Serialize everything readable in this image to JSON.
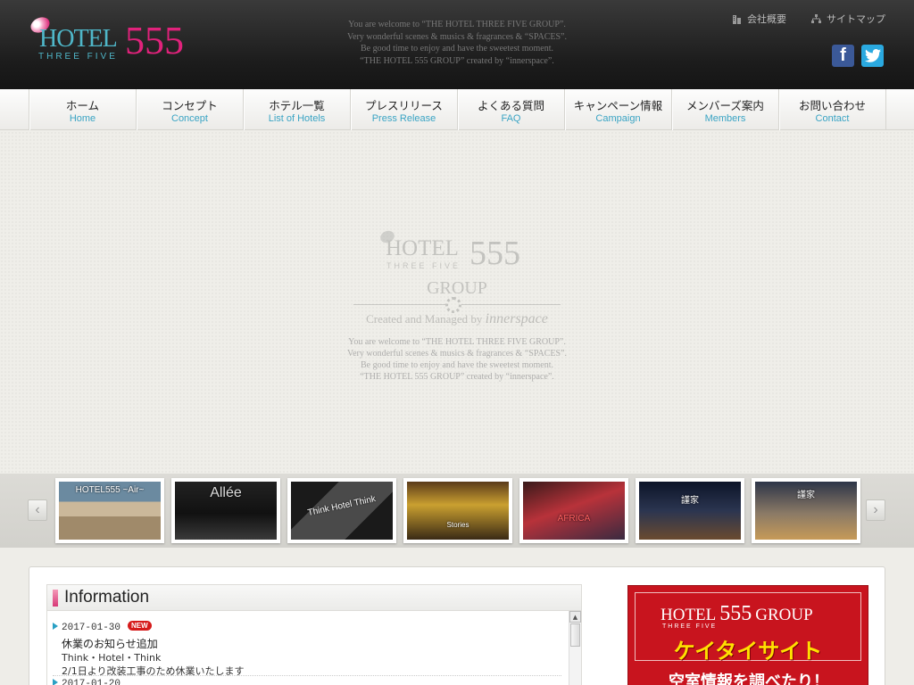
{
  "header": {
    "logo": {
      "hotel": "HOTEL",
      "three_five": "THREE FIVE",
      "number": "555"
    },
    "welcome_lines": [
      "You are welcome to “THE HOTEL THREE FIVE GROUP”.",
      "Very wonderful scenes & musics & fragrances & “SPACES”.",
      "Be good time to enjoy and have the sweetest moment.",
      "“THE HOTEL 555 GROUP” created by “innerspace”."
    ],
    "top_links": [
      {
        "label": "会社概要",
        "icon": "building-icon"
      },
      {
        "label": "サイトマップ",
        "icon": "sitemap-icon"
      }
    ],
    "social": {
      "facebook": "f",
      "twitter": "twitter-bird-icon"
    }
  },
  "nav": [
    {
      "ja": "ホーム",
      "en": "Home"
    },
    {
      "ja": "コンセプト",
      "en": "Concept"
    },
    {
      "ja": "ホテル一覧",
      "en": "List of Hotels"
    },
    {
      "ja": "プレスリリース",
      "en": "Press Release"
    },
    {
      "ja": "よくある質問",
      "en": "FAQ"
    },
    {
      "ja": "キャンペーン情報",
      "en": "Campaign"
    },
    {
      "ja": "メンバーズ案内",
      "en": "Members"
    },
    {
      "ja": "お問い合わせ",
      "en": "Contact"
    }
  ],
  "hero": {
    "hotel": "HOTEL",
    "three_five": "THREE FIVE",
    "number": "555",
    "group": "GROUP",
    "created": "Created and Managed by",
    "brand": "innerspace",
    "welcome_lines": [
      "You are welcome to “THE HOTEL THREE FIVE GROUP”.",
      "Very wonderful scenes & musics & fragrances & “SPACES”.",
      "Be good time to enjoy and have the sweetest moment.",
      "“THE HOTEL 555 GROUP” created by “innerspace”."
    ]
  },
  "carousel": {
    "prev": "‹",
    "next": "›",
    "thumbs": [
      {
        "label": "HOTEL555 ~Air~"
      },
      {
        "label": "Allée"
      },
      {
        "label": "Think Hotel Think"
      },
      {
        "label": "Stories"
      },
      {
        "label": "AFRICA"
      },
      {
        "label": "謹家"
      },
      {
        "label": "謹家"
      }
    ]
  },
  "information": {
    "heading": "Information",
    "entries": [
      {
        "date": "2017-01-30",
        "badge": "NEW",
        "title": "休業のお知らせ追加",
        "lines": [
          "Think・Hotel・Think",
          "2/1日より改装工事のため休業いたします"
        ]
      }
    ],
    "next_date": "2017-01-20"
  },
  "mobile_banner": {
    "hotel": "HOTEL",
    "three_five": "THREE FIVE",
    "number": "555",
    "group": "GROUP",
    "title": "ケイタイサイト",
    "subtitle": "空室情報を調べたり！"
  },
  "colors": {
    "accent_pink": "#e0227b",
    "accent_teal": "#4fb7c9",
    "nav_en": "#3aa4c4",
    "banner_red": "#c8141e"
  }
}
